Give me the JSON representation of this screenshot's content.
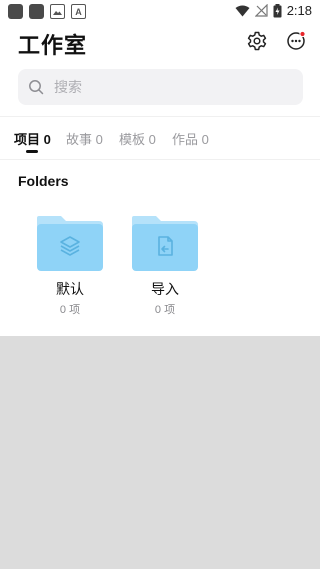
{
  "status_bar": {
    "time": "2:18",
    "notif_letter": "A"
  },
  "header": {
    "title": "工作室"
  },
  "search": {
    "placeholder": "搜索"
  },
  "tabs": [
    {
      "label": "项目 0",
      "active": true
    },
    {
      "label": "故事 0",
      "active": false
    },
    {
      "label": "模板 0",
      "active": false
    },
    {
      "label": "作品 0",
      "active": false
    }
  ],
  "folders_section": {
    "title": "Folders"
  },
  "folders": [
    {
      "name": "默认",
      "count": "0 项",
      "icon": "layers-icon"
    },
    {
      "name": "导入",
      "count": "0 项",
      "icon": "import-file-icon"
    }
  ],
  "colors": {
    "folder": "#8fd3f7",
    "folder_tab": "#b5e2fa",
    "folder_icon": "#5ab2e0",
    "notification_dot": "#e8262b"
  }
}
